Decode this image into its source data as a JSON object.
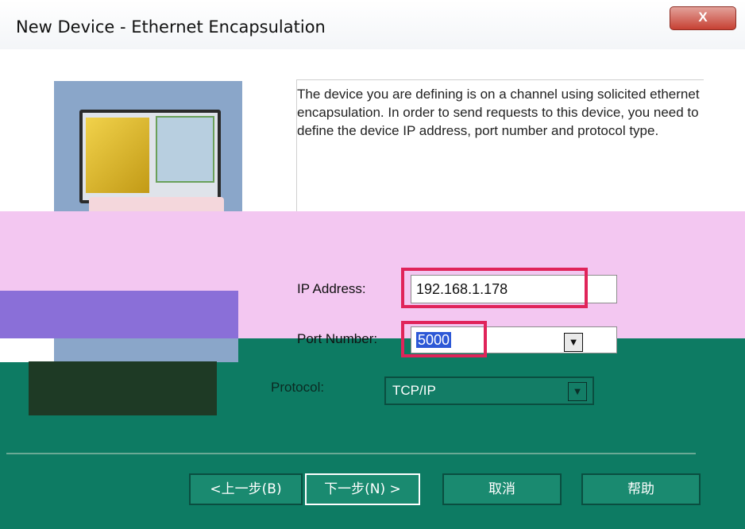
{
  "window": {
    "title": "New Device - Ethernet Encapsulation",
    "close_label": "X"
  },
  "description": "The device you are defining is on a channel using solicited ethernet encapsulation.  In order to send requests to this device, you need to define the device IP address, port number and protocol type.",
  "form": {
    "ip_label": "IP Address:",
    "ip_value": "192.168.1.178",
    "port_label": "Port Number:",
    "port_value": "5000",
    "protocol_label": "Protocol:",
    "protocol_value": "TCP/IP"
  },
  "buttons": {
    "back": "<上一步(B)",
    "next": "下一步(N) >",
    "cancel": "取消",
    "help": "帮助"
  },
  "colors": {
    "highlight": "#e0245a",
    "accent": "#0d7b63"
  }
}
